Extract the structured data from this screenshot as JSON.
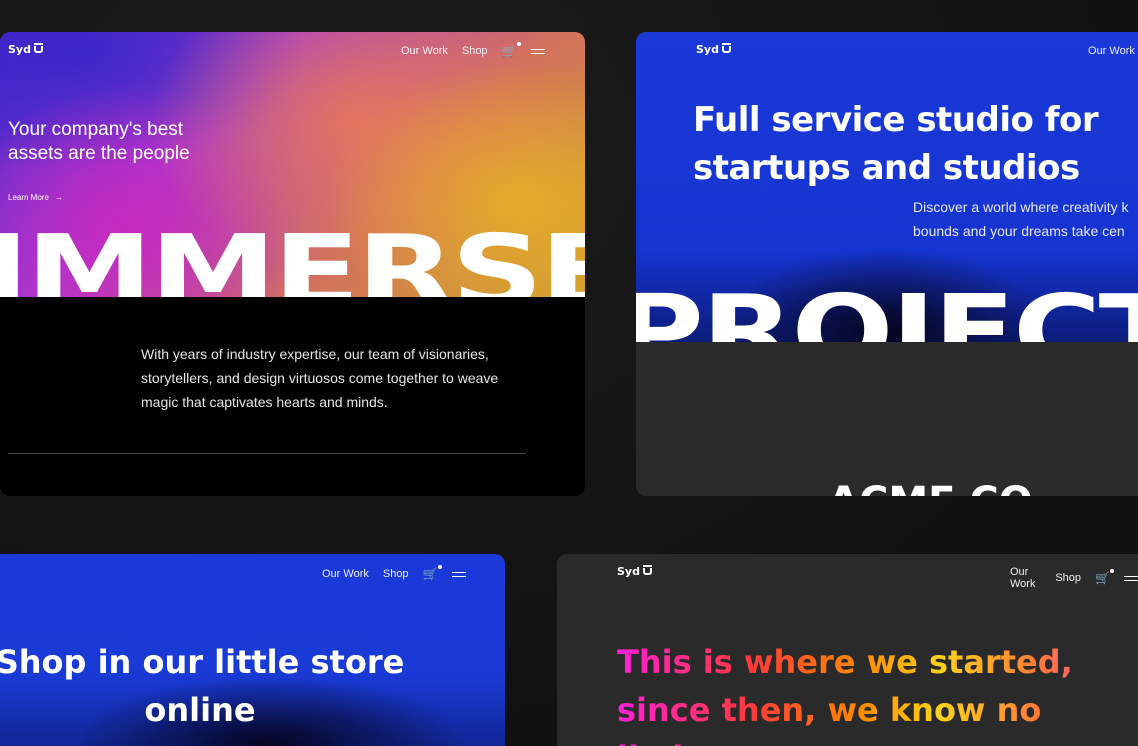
{
  "colors": {
    "blue": "#1a39d8",
    "dark_card": "#2b2b2b",
    "black_card": "#000000",
    "gradient_pink": "#ff1fd6",
    "gradient_orange": "#ff8a00",
    "gradient_yellow": "#ffd21a"
  },
  "card1": {
    "logo": "Syd",
    "nav": {
      "our_work": "Our Work",
      "shop": "Shop"
    },
    "tagline": "Your company's best assets are the people",
    "learn_more": "Learn More",
    "big_word": "IMMERSE",
    "paragraph": "With years of industry expertise, our team of visionaries, storytellers, and design virtuosos come together to weave magic that captivates hearts and minds."
  },
  "card2": {
    "logo": "Syd",
    "nav": {
      "our_work": "Our Work"
    },
    "headline_line1": "Full service studio for",
    "headline_line2": "startups and studios",
    "sub_line1": "Discover a world where creativity k",
    "sub_line2": "bounds and your dreams take cen",
    "big_word": "PROJECTS",
    "footer_word": "ACME CO"
  },
  "card3": {
    "nav": {
      "our_work": "Our Work",
      "shop": "Shop"
    },
    "headline_line1": "Shop in our little store",
    "headline_line2": "online"
  },
  "card4": {
    "logo": "Syd",
    "nav": {
      "our_work": "Our Work",
      "shop": "Shop"
    },
    "headline_line1": "This is where we started,",
    "headline_line2": "since then, we know no",
    "headline_line3": "limits"
  },
  "icons": {
    "cart": "cart-icon",
    "menu": "menu-icon",
    "arrow": "arrow-right-icon"
  }
}
